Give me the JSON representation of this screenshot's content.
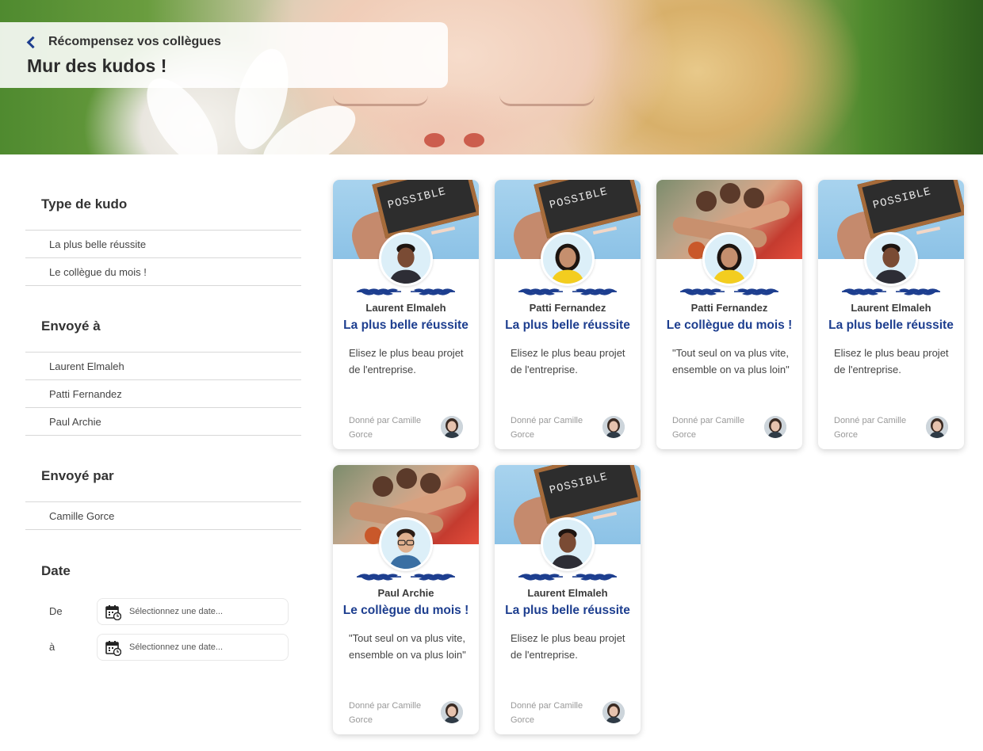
{
  "header": {
    "back_label": "Récompensez vos collègues",
    "title": "Mur des kudos !"
  },
  "filters": {
    "type": {
      "title": "Type de kudo",
      "items": [
        "La plus belle réussite",
        "Le collègue du mois !"
      ]
    },
    "sent_to": {
      "title": "Envoyé à",
      "items": [
        "Laurent Elmaleh",
        "Patti Fernandez",
        "Paul Archie"
      ]
    },
    "sent_by": {
      "title": "Envoyé par",
      "items": [
        "Camille Gorce"
      ]
    },
    "date": {
      "title": "Date",
      "from_label": "De",
      "to_label": "à",
      "placeholder": "Sélectionnez une date..."
    }
  },
  "cards": [
    {
      "recipient": "Laurent Elmaleh",
      "type": "La plus belle réussite",
      "message": "Elisez le plus beau projet de l'entreprise.",
      "giver": "Donné par Camille Gorce",
      "image": "slate-possible",
      "avatar": "man-smiling"
    },
    {
      "recipient": "Patti Fernandez",
      "type": "La plus belle réussite",
      "message": "Elisez le plus beau projet de l'entreprise.",
      "giver": "Donné par Camille Gorce",
      "image": "slate-possible",
      "avatar": "woman-yellow"
    },
    {
      "recipient": "Patti Fernandez",
      "type": "Le collègue du mois !",
      "message": "\"Tout seul on va plus vite, ensemble on va plus loin\"",
      "giver": "Donné par Camille Gorce",
      "image": "team-hands",
      "avatar": "woman-yellow"
    },
    {
      "recipient": "Laurent Elmaleh",
      "type": "La plus belle réussite",
      "message": "Elisez le plus beau projet de l'entreprise.",
      "giver": "Donné par Camille Gorce",
      "image": "slate-possible",
      "avatar": "man-smiling"
    },
    {
      "recipient": "Paul Archie",
      "type": "Le collègue du mois !",
      "message": "\"Tout seul on va plus vite, ensemble on va plus loin\"",
      "giver": "Donné par Camille Gorce",
      "image": "team-hands",
      "avatar": "man-glasses"
    },
    {
      "recipient": "Laurent Elmaleh",
      "type": "La plus belle réussite",
      "message": "Elisez le plus beau projet de l'entreprise.",
      "giver": "Donné par Camille Gorce",
      "image": "slate-possible",
      "avatar": "man-smiling"
    }
  ],
  "slate_text": "POSSIBLE",
  "colors": {
    "accent": "#1d3e8f",
    "text": "#333333",
    "muted": "#999999"
  }
}
